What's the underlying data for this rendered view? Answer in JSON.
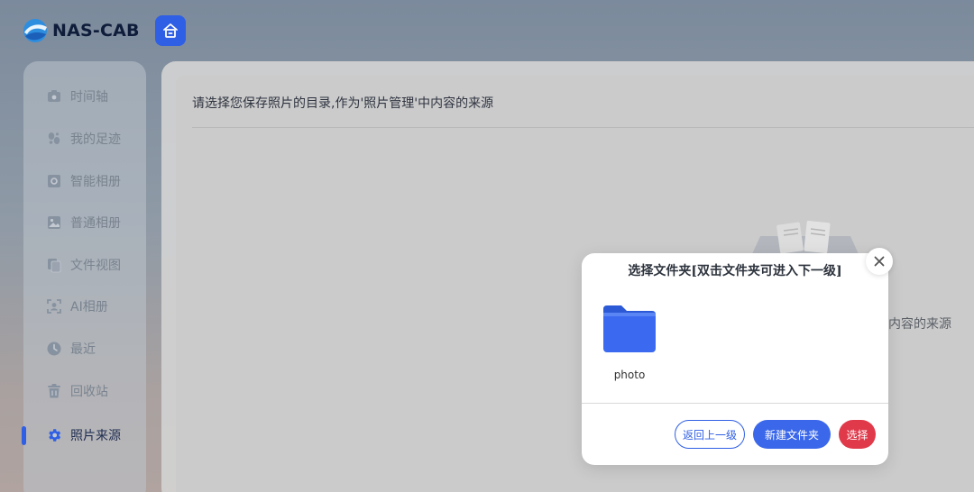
{
  "header": {
    "logo_text": "NAS-CAB",
    "logo_icon": "nas-cab-logo-icon",
    "home_icon": "home-icon"
  },
  "sidebar": {
    "items": [
      {
        "label": "时间轴",
        "icon": "timeline-icon",
        "active": false
      },
      {
        "label": "我的足迹",
        "icon": "footprint-icon",
        "active": false
      },
      {
        "label": "智能相册",
        "icon": "smart-album-icon",
        "active": false
      },
      {
        "label": "普通相册",
        "icon": "image-icon",
        "active": false
      },
      {
        "label": "文件视图",
        "icon": "file-view-icon",
        "active": false
      },
      {
        "label": "AI相册",
        "icon": "ai-face-icon",
        "active": false
      },
      {
        "label": "最近",
        "icon": "clock-icon",
        "active": false
      },
      {
        "label": "回收站",
        "icon": "trash-icon",
        "active": false
      },
      {
        "label": "照片来源",
        "icon": "gear-icon",
        "active": true
      }
    ]
  },
  "main": {
    "title": "请选择您保存照片的目录,作为'照片管理'中内容的来源",
    "background_text": "内容的来源"
  },
  "dialog": {
    "title": "选择文件夹[双击文件夹可进入下一级]",
    "folders": [
      {
        "name": "photo",
        "icon": "folder-icon"
      }
    ],
    "buttons": {
      "back": "返回上一级",
      "new_folder": "新建文件夹",
      "select": "选择"
    }
  },
  "colors": {
    "accent": "#2f5fe4",
    "danger": "#e0394a",
    "folder": "#3b6af0"
  }
}
